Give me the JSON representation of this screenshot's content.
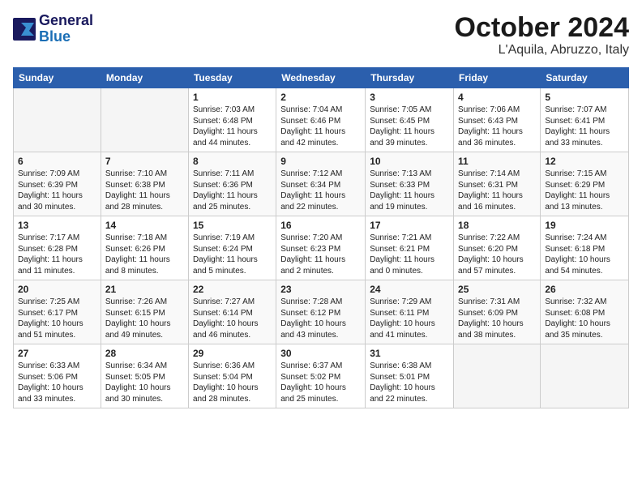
{
  "header": {
    "logo_line1": "General",
    "logo_line2": "Blue",
    "month_title": "October 2024",
    "location": "L'Aquila, Abruzzo, Italy"
  },
  "columns": [
    "Sunday",
    "Monday",
    "Tuesday",
    "Wednesday",
    "Thursday",
    "Friday",
    "Saturday"
  ],
  "weeks": [
    [
      {
        "day": "",
        "info": ""
      },
      {
        "day": "",
        "info": ""
      },
      {
        "day": "1",
        "info": "Sunrise: 7:03 AM\nSunset: 6:48 PM\nDaylight: 11 hours and 44 minutes."
      },
      {
        "day": "2",
        "info": "Sunrise: 7:04 AM\nSunset: 6:46 PM\nDaylight: 11 hours and 42 minutes."
      },
      {
        "day": "3",
        "info": "Sunrise: 7:05 AM\nSunset: 6:45 PM\nDaylight: 11 hours and 39 minutes."
      },
      {
        "day": "4",
        "info": "Sunrise: 7:06 AM\nSunset: 6:43 PM\nDaylight: 11 hours and 36 minutes."
      },
      {
        "day": "5",
        "info": "Sunrise: 7:07 AM\nSunset: 6:41 PM\nDaylight: 11 hours and 33 minutes."
      }
    ],
    [
      {
        "day": "6",
        "info": "Sunrise: 7:09 AM\nSunset: 6:39 PM\nDaylight: 11 hours and 30 minutes."
      },
      {
        "day": "7",
        "info": "Sunrise: 7:10 AM\nSunset: 6:38 PM\nDaylight: 11 hours and 28 minutes."
      },
      {
        "day": "8",
        "info": "Sunrise: 7:11 AM\nSunset: 6:36 PM\nDaylight: 11 hours and 25 minutes."
      },
      {
        "day": "9",
        "info": "Sunrise: 7:12 AM\nSunset: 6:34 PM\nDaylight: 11 hours and 22 minutes."
      },
      {
        "day": "10",
        "info": "Sunrise: 7:13 AM\nSunset: 6:33 PM\nDaylight: 11 hours and 19 minutes."
      },
      {
        "day": "11",
        "info": "Sunrise: 7:14 AM\nSunset: 6:31 PM\nDaylight: 11 hours and 16 minutes."
      },
      {
        "day": "12",
        "info": "Sunrise: 7:15 AM\nSunset: 6:29 PM\nDaylight: 11 hours and 13 minutes."
      }
    ],
    [
      {
        "day": "13",
        "info": "Sunrise: 7:17 AM\nSunset: 6:28 PM\nDaylight: 11 hours and 11 minutes."
      },
      {
        "day": "14",
        "info": "Sunrise: 7:18 AM\nSunset: 6:26 PM\nDaylight: 11 hours and 8 minutes."
      },
      {
        "day": "15",
        "info": "Sunrise: 7:19 AM\nSunset: 6:24 PM\nDaylight: 11 hours and 5 minutes."
      },
      {
        "day": "16",
        "info": "Sunrise: 7:20 AM\nSunset: 6:23 PM\nDaylight: 11 hours and 2 minutes."
      },
      {
        "day": "17",
        "info": "Sunrise: 7:21 AM\nSunset: 6:21 PM\nDaylight: 11 hours and 0 minutes."
      },
      {
        "day": "18",
        "info": "Sunrise: 7:22 AM\nSunset: 6:20 PM\nDaylight: 10 hours and 57 minutes."
      },
      {
        "day": "19",
        "info": "Sunrise: 7:24 AM\nSunset: 6:18 PM\nDaylight: 10 hours and 54 minutes."
      }
    ],
    [
      {
        "day": "20",
        "info": "Sunrise: 7:25 AM\nSunset: 6:17 PM\nDaylight: 10 hours and 51 minutes."
      },
      {
        "day": "21",
        "info": "Sunrise: 7:26 AM\nSunset: 6:15 PM\nDaylight: 10 hours and 49 minutes."
      },
      {
        "day": "22",
        "info": "Sunrise: 7:27 AM\nSunset: 6:14 PM\nDaylight: 10 hours and 46 minutes."
      },
      {
        "day": "23",
        "info": "Sunrise: 7:28 AM\nSunset: 6:12 PM\nDaylight: 10 hours and 43 minutes."
      },
      {
        "day": "24",
        "info": "Sunrise: 7:29 AM\nSunset: 6:11 PM\nDaylight: 10 hours and 41 minutes."
      },
      {
        "day": "25",
        "info": "Sunrise: 7:31 AM\nSunset: 6:09 PM\nDaylight: 10 hours and 38 minutes."
      },
      {
        "day": "26",
        "info": "Sunrise: 7:32 AM\nSunset: 6:08 PM\nDaylight: 10 hours and 35 minutes."
      }
    ],
    [
      {
        "day": "27",
        "info": "Sunrise: 6:33 AM\nSunset: 5:06 PM\nDaylight: 10 hours and 33 minutes."
      },
      {
        "day": "28",
        "info": "Sunrise: 6:34 AM\nSunset: 5:05 PM\nDaylight: 10 hours and 30 minutes."
      },
      {
        "day": "29",
        "info": "Sunrise: 6:36 AM\nSunset: 5:04 PM\nDaylight: 10 hours and 28 minutes."
      },
      {
        "day": "30",
        "info": "Sunrise: 6:37 AM\nSunset: 5:02 PM\nDaylight: 10 hours and 25 minutes."
      },
      {
        "day": "31",
        "info": "Sunrise: 6:38 AM\nSunset: 5:01 PM\nDaylight: 10 hours and 22 minutes."
      },
      {
        "day": "",
        "info": ""
      },
      {
        "day": "",
        "info": ""
      }
    ]
  ]
}
